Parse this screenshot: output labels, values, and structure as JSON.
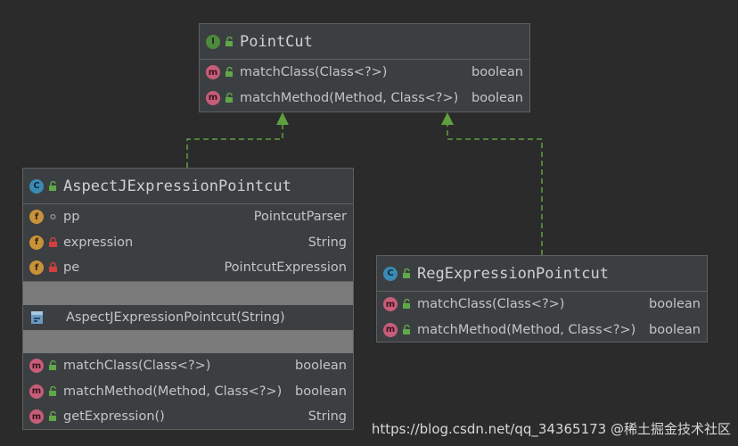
{
  "colors": {
    "background": "#2b2b2b",
    "box_fill": "#3c3f41",
    "box_border": "#5e6060",
    "interface_badge": "#4e8a3c",
    "class_badge": "#3b8ab5",
    "method_badge": "#c75d79",
    "field_badge": "#c8923a",
    "public_lock": "#5fa84a",
    "private_lock": "#d04040",
    "arrow": "#5f9f3f"
  },
  "pointcut": {
    "kind": "I",
    "name": "PointCut",
    "methods": [
      {
        "icon": "m",
        "name": "matchClass(Class<?>)",
        "type": "boolean"
      },
      {
        "icon": "m",
        "name": "matchMethod(Method, Class<?>)",
        "type": "boolean"
      }
    ]
  },
  "aspectj": {
    "kind": "C",
    "name": "AspectJExpressionPointcut",
    "fields": [
      {
        "icon": "f",
        "access": "package",
        "name": "pp",
        "type": "PointcutParser"
      },
      {
        "icon": "f",
        "access": "private",
        "name": "expression",
        "type": "String"
      },
      {
        "icon": "f",
        "access": "private",
        "name": "pe",
        "type": "PointcutExpression"
      }
    ],
    "constructor": "AspectJExpressionPointcut(String)",
    "methods": [
      {
        "icon": "m",
        "name": "matchClass(Class<?>)",
        "type": "boolean"
      },
      {
        "icon": "m",
        "name": "matchMethod(Method, Class<?>)",
        "type": "boolean"
      },
      {
        "icon": "m",
        "name": "getExpression()",
        "type": "String"
      }
    ]
  },
  "regex": {
    "kind": "C",
    "name": "RegExpressionPointcut",
    "methods": [
      {
        "icon": "m",
        "name": "matchClass(Class<?>)",
        "type": "boolean"
      },
      {
        "icon": "m",
        "name": "matchMethod(Method, Class<?>)",
        "type": "boolean"
      }
    ]
  },
  "relations": [
    {
      "from": "AspectJExpressionPointcut",
      "to": "PointCut",
      "kind": "implements"
    },
    {
      "from": "RegExpressionPointcut",
      "to": "PointCut",
      "kind": "implements"
    }
  ],
  "watermark": "https://blog.csdn.net/qq_34365173 @稀土掘金技术社区"
}
